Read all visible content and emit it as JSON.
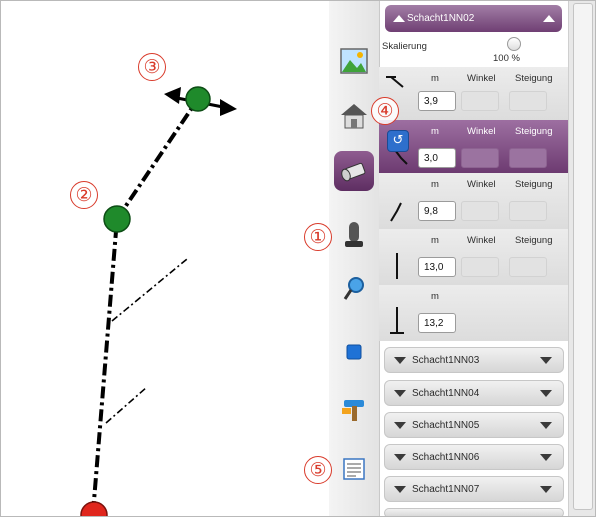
{
  "header": {
    "title": "Schacht1NN02"
  },
  "scaling": {
    "label": "Skalierung",
    "value": "100 %"
  },
  "columns": {
    "m": "m",
    "winkel": "Winkel",
    "steigung": "Steigung"
  },
  "segments": [
    {
      "m_value": "3,9",
      "winkel": "",
      "steigung": ""
    },
    {
      "m_value": "3,0",
      "winkel": "",
      "steigung": ""
    },
    {
      "m_value": "9,8",
      "winkel": "",
      "steigung": ""
    },
    {
      "m_value": "13,0",
      "winkel": "",
      "steigung": ""
    },
    {
      "m_value": "13,2"
    }
  ],
  "collapsed_sections": [
    "Schacht1NN03",
    "Schacht1NN04",
    "Schacht1NN05",
    "Schacht1NN06",
    "Schacht1NN07"
  ],
  "tools": [
    "landscape-icon",
    "house-icon",
    "pipe-icon",
    "manhole-icon",
    "search-icon",
    "square-icon",
    "hammer-icon",
    "notes-icon"
  ],
  "callouts": [
    "①",
    "②",
    "③",
    "④",
    "⑤"
  ],
  "colors": {
    "node_green": "#1f8a2b",
    "node_red": "#e0261d",
    "accent_purple": "#6f3f73",
    "callout_red": "#d93b2b"
  }
}
